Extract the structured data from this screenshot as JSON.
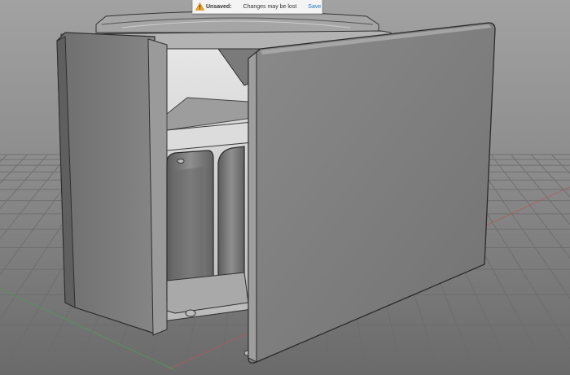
{
  "notification": {
    "title": "Unsaved:",
    "message": "Changes may be lost",
    "save_label": "Save",
    "icon": "warning-icon"
  },
  "scene": {
    "object": "enclosure-model",
    "colors": {
      "background_top": "#9a9a9a",
      "background_bottom": "#6f6f6f",
      "grid": "#6c6c6c",
      "axis_x": "#b05a5a",
      "axis_y": "#4f9a5a",
      "body_face": "#7c7c7c",
      "body_edge": "#2e2e2e",
      "interior": "#cfcfcf",
      "warning": "#f4a425",
      "link": "#1f76c2"
    }
  }
}
